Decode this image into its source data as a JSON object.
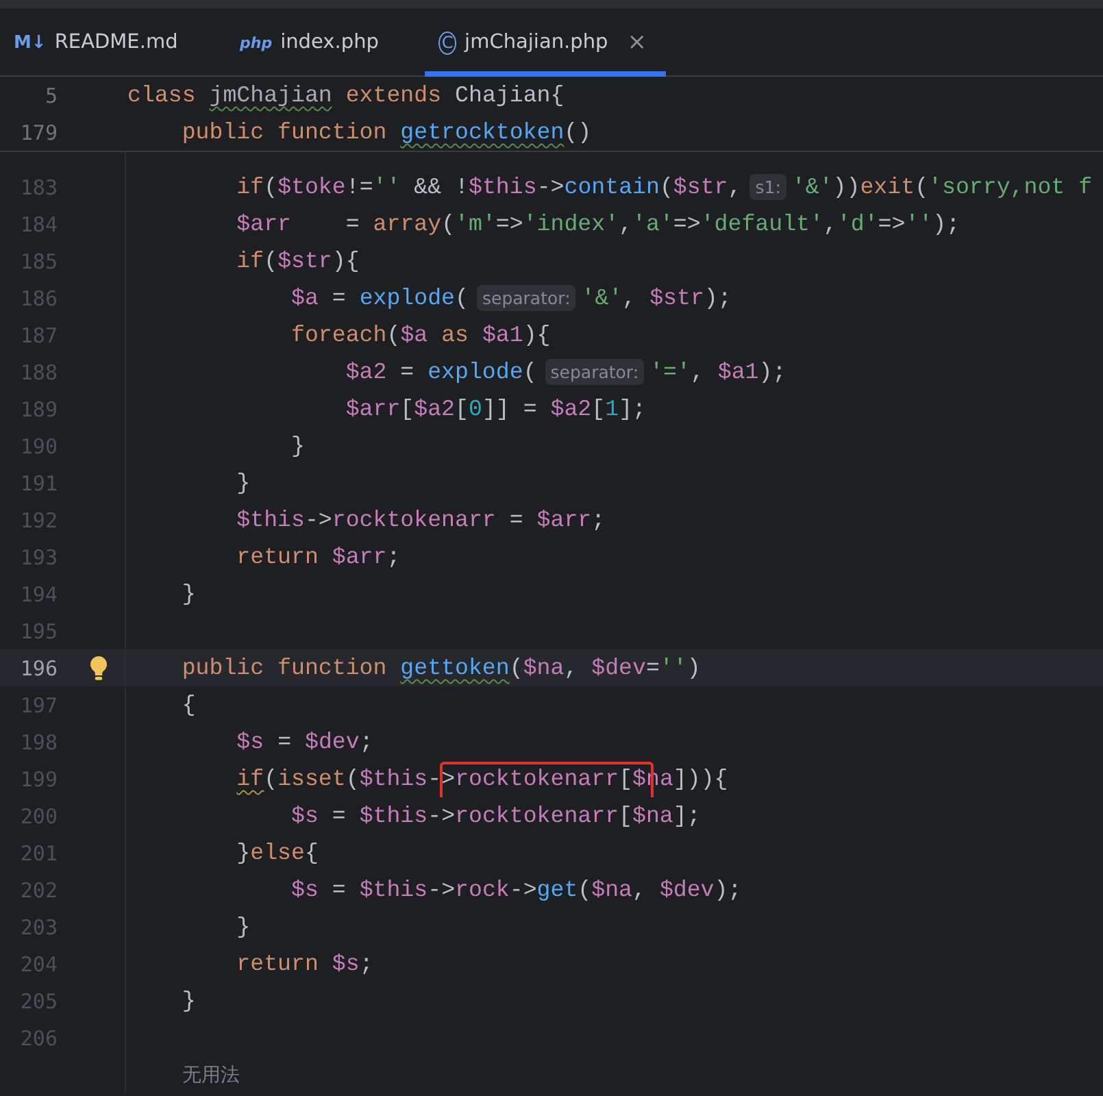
{
  "tabs": [
    {
      "kind": "markdown",
      "icon_text": "M↓",
      "label": "README.md",
      "selected": false
    },
    {
      "kind": "php",
      "icon_text": "php",
      "label": "index.php",
      "selected": false
    },
    {
      "kind": "class",
      "icon_text": "C",
      "label": "jmChajian.php",
      "selected": true,
      "close": "×"
    }
  ],
  "sticky_lines": [
    {
      "number": "5",
      "segments": [
        {
          "kind": "code",
          "tokens": [
            {
              "color": "#cf8e6d",
              "t": "class "
            },
            {
              "color": "#a9abb0",
              "t": "jmChajian",
              "typo": true
            },
            {
              "color": "#cf8e6d",
              "t": " extends"
            },
            {
              "color": "#bcbec4",
              "t": " Chajian{"
            }
          ]
        }
      ]
    },
    {
      "number": "179",
      "segments": [
        {
          "kind": "code",
          "tokens": [
            {
              "color": "#cf8e6d",
              "t": "    public function "
            },
            {
              "color": "#56a8f5",
              "t": "getrocktoken",
              "typo": true
            },
            {
              "color": "#bcbec4",
              "t": "()"
            }
          ]
        }
      ]
    }
  ],
  "lines": [
    {
      "number": "183",
      "segments": [
        {
          "kind": "code",
          "tokens": [
            {
              "color": "#cf8e6d",
              "t": "        if"
            },
            {
              "color": "#bcbec4",
              "t": "("
            },
            {
              "color": "#c77dbb",
              "t": "$toke"
            },
            {
              "color": "#bcbec4",
              "t": "!="
            },
            {
              "color": "#6aab73",
              "t": "''"
            },
            {
              "color": "#bcbec4",
              "t": " && !"
            },
            {
              "color": "#c77dbb",
              "t": "$this"
            },
            {
              "color": "#bcbec4",
              "t": "->"
            },
            {
              "color": "#56a8f5",
              "t": "contain"
            },
            {
              "color": "#bcbec4",
              "t": "("
            },
            {
              "color": "#c77dbb",
              "t": "$str"
            },
            {
              "color": "#bcbec4",
              "t": ","
            }
          ]
        },
        {
          "kind": "hint",
          "text": "s1:"
        },
        {
          "kind": "code",
          "tokens": [
            {
              "color": "#6aab73",
              "t": "'&'"
            },
            {
              "color": "#bcbec4",
              "t": "))"
            },
            {
              "color": "#cf8e6d",
              "t": "exit"
            },
            {
              "color": "#bcbec4",
              "t": "("
            },
            {
              "color": "#6aab73",
              "t": "'sorry,not f"
            }
          ]
        }
      ]
    },
    {
      "number": "184",
      "segments": [
        {
          "kind": "code",
          "tokens": [
            {
              "color": "#c77dbb",
              "t": "        $arr"
            },
            {
              "color": "#bcbec4",
              "t": "    = "
            },
            {
              "color": "#cf8e6d",
              "t": "array"
            },
            {
              "color": "#bcbec4",
              "t": "("
            },
            {
              "color": "#6aab73",
              "t": "'m'"
            },
            {
              "color": "#bcbec4",
              "t": "=>"
            },
            {
              "color": "#6aab73",
              "t": "'index'"
            },
            {
              "color": "#bcbec4",
              "t": ","
            },
            {
              "color": "#6aab73",
              "t": "'a'"
            },
            {
              "color": "#bcbec4",
              "t": "=>"
            },
            {
              "color": "#6aab73",
              "t": "'default'"
            },
            {
              "color": "#bcbec4",
              "t": ","
            },
            {
              "color": "#6aab73",
              "t": "'d'"
            },
            {
              "color": "#bcbec4",
              "t": "=>"
            },
            {
              "color": "#6aab73",
              "t": "''"
            },
            {
              "color": "#bcbec4",
              "t": ");"
            }
          ]
        }
      ]
    },
    {
      "number": "185",
      "segments": [
        {
          "kind": "code",
          "tokens": [
            {
              "color": "#cf8e6d",
              "t": "        if"
            },
            {
              "color": "#bcbec4",
              "t": "("
            },
            {
              "color": "#c77dbb",
              "t": "$str"
            },
            {
              "color": "#bcbec4",
              "t": "){"
            }
          ]
        }
      ]
    },
    {
      "number": "186",
      "segments": [
        {
          "kind": "code",
          "tokens": [
            {
              "color": "#c77dbb",
              "t": "            $a"
            },
            {
              "color": "#bcbec4",
              "t": " = "
            },
            {
              "color": "#56a8f5",
              "t": "explode"
            },
            {
              "color": "#bcbec4",
              "t": "("
            }
          ]
        },
        {
          "kind": "hint",
          "text": "separator:"
        },
        {
          "kind": "code",
          "tokens": [
            {
              "color": "#6aab73",
              "t": "'&'"
            },
            {
              "color": "#bcbec4",
              "t": ", "
            },
            {
              "color": "#c77dbb",
              "t": "$str"
            },
            {
              "color": "#bcbec4",
              "t": ");"
            }
          ]
        }
      ]
    },
    {
      "number": "187",
      "segments": [
        {
          "kind": "code",
          "tokens": [
            {
              "color": "#cf8e6d",
              "t": "            foreach"
            },
            {
              "color": "#bcbec4",
              "t": "("
            },
            {
              "color": "#c77dbb",
              "t": "$a "
            },
            {
              "color": "#cf8e6d",
              "t": "as "
            },
            {
              "color": "#c77dbb",
              "t": "$a1"
            },
            {
              "color": "#bcbec4",
              "t": "){"
            }
          ]
        }
      ]
    },
    {
      "number": "188",
      "segments": [
        {
          "kind": "code",
          "tokens": [
            {
              "color": "#c77dbb",
              "t": "                $a2"
            },
            {
              "color": "#bcbec4",
              "t": " = "
            },
            {
              "color": "#56a8f5",
              "t": "explode"
            },
            {
              "color": "#bcbec4",
              "t": "("
            }
          ]
        },
        {
          "kind": "hint",
          "text": "separator:"
        },
        {
          "kind": "code",
          "tokens": [
            {
              "color": "#6aab73",
              "t": "'='"
            },
            {
              "color": "#bcbec4",
              "t": ", "
            },
            {
              "color": "#c77dbb",
              "t": "$a1"
            },
            {
              "color": "#bcbec4",
              "t": ");"
            }
          ]
        }
      ]
    },
    {
      "number": "189",
      "segments": [
        {
          "kind": "code",
          "tokens": [
            {
              "color": "#c77dbb",
              "t": "                $arr"
            },
            {
              "color": "#bcbec4",
              "t": "["
            },
            {
              "color": "#c77dbb",
              "t": "$a2"
            },
            {
              "color": "#bcbec4",
              "t": "["
            },
            {
              "color": "#2aacb8",
              "t": "0"
            },
            {
              "color": "#bcbec4",
              "t": "]] = "
            },
            {
              "color": "#c77dbb",
              "t": "$a2"
            },
            {
              "color": "#bcbec4",
              "t": "["
            },
            {
              "color": "#2aacb8",
              "t": "1"
            },
            {
              "color": "#bcbec4",
              "t": "];"
            }
          ]
        }
      ]
    },
    {
      "number": "190",
      "segments": [
        {
          "kind": "code",
          "tokens": [
            {
              "color": "#bcbec4",
              "t": "            }"
            }
          ]
        }
      ]
    },
    {
      "number": "191",
      "segments": [
        {
          "kind": "code",
          "tokens": [
            {
              "color": "#bcbec4",
              "t": "        }"
            }
          ]
        }
      ]
    },
    {
      "number": "192",
      "segments": [
        {
          "kind": "code",
          "tokens": [
            {
              "color": "#c77dbb",
              "t": "        $this"
            },
            {
              "color": "#bcbec4",
              "t": "->"
            },
            {
              "color": "#c77dbb",
              "t": "rocktokenarr"
            },
            {
              "color": "#bcbec4",
              "t": " = "
            },
            {
              "color": "#c77dbb",
              "t": "$arr"
            },
            {
              "color": "#bcbec4",
              "t": ";"
            }
          ]
        }
      ]
    },
    {
      "number": "193",
      "segments": [
        {
          "kind": "code",
          "tokens": [
            {
              "color": "#cf8e6d",
              "t": "        return "
            },
            {
              "color": "#c77dbb",
              "t": "$arr"
            },
            {
              "color": "#bcbec4",
              "t": ";"
            }
          ]
        }
      ]
    },
    {
      "number": "194",
      "segments": [
        {
          "kind": "code",
          "tokens": [
            {
              "color": "#bcbec4",
              "t": "    }"
            }
          ]
        }
      ]
    },
    {
      "number": "195"
    },
    {
      "number": "196",
      "current": true,
      "bulb": true,
      "segments": [
        {
          "kind": "code",
          "tokens": [
            {
              "color": "#cf8e6d",
              "t": "    public function "
            },
            {
              "color": "#56a8f5",
              "t": "gettoken",
              "typo": true
            },
            {
              "color": "#bcbec4",
              "t": "("
            },
            {
              "color": "#c77dbb",
              "t": "$na"
            },
            {
              "color": "#bcbec4",
              "t": ", "
            },
            {
              "color": "#c77dbb",
              "t": "$dev"
            },
            {
              "color": "#bcbec4",
              "t": "="
            },
            {
              "color": "#6aab73",
              "t": "''"
            },
            {
              "color": "#bcbec4",
              "t": ")"
            }
          ]
        }
      ]
    },
    {
      "number": "197",
      "segments": [
        {
          "kind": "code",
          "tokens": [
            {
              "color": "#bcbec4",
              "t": "    {"
            }
          ]
        }
      ]
    },
    {
      "number": "198",
      "segments": [
        {
          "kind": "code",
          "tokens": [
            {
              "color": "#c77dbb",
              "t": "        $s"
            },
            {
              "color": "#bcbec4",
              "t": " = "
            },
            {
              "color": "#c77dbb",
              "t": "$dev"
            },
            {
              "color": "#bcbec4",
              "t": ";"
            }
          ]
        }
      ]
    },
    {
      "number": "199",
      "segments": [
        {
          "kind": "code",
          "tokens": [
            {
              "color": "#cf8e6d",
              "t": "        if",
              "warning": true
            },
            {
              "color": "#bcbec4",
              "t": "("
            },
            {
              "color": "#cf8e6d",
              "t": "isset"
            },
            {
              "color": "#bcbec4",
              "t": "("
            },
            {
              "color": "#c77dbb",
              "t": "$this"
            },
            {
              "color": "#bcbec4",
              "t": "-"
            },
            {
              "color": "#bcbec4",
              "t": ">",
              "boxed": true
            },
            {
              "color": "#c77dbb",
              "t": "rocktokenarr",
              "boxed": true
            },
            {
              "color": "#bcbec4",
              "t": "[",
              "boxed": true
            },
            {
              "color": "#c77dbb",
              "t": "$",
              "boxed": true
            },
            {
              "color": "#c77dbb",
              "t": "na"
            },
            {
              "color": "#bcbec4",
              "t": "])){"
            }
          ]
        }
      ]
    },
    {
      "number": "200",
      "segments": [
        {
          "kind": "code",
          "tokens": [
            {
              "color": "#c77dbb",
              "t": "            $s"
            },
            {
              "color": "#bcbec4",
              "t": " = "
            },
            {
              "color": "#c77dbb",
              "t": "$this"
            },
            {
              "color": "#bcbec4",
              "t": "->"
            },
            {
              "color": "#c77dbb",
              "t": "rocktokenarr"
            },
            {
              "color": "#bcbec4",
              "t": "["
            },
            {
              "color": "#c77dbb",
              "t": "$na"
            },
            {
              "color": "#bcbec4",
              "t": "];"
            }
          ]
        }
      ]
    },
    {
      "number": "201",
      "segments": [
        {
          "kind": "code",
          "tokens": [
            {
              "color": "#bcbec4",
              "t": "        }"
            },
            {
              "color": "#cf8e6d",
              "t": "else"
            },
            {
              "color": "#bcbec4",
              "t": "{"
            }
          ]
        }
      ]
    },
    {
      "number": "202",
      "segments": [
        {
          "kind": "code",
          "tokens": [
            {
              "color": "#c77dbb",
              "t": "            $s"
            },
            {
              "color": "#bcbec4",
              "t": " = "
            },
            {
              "color": "#c77dbb",
              "t": "$this"
            },
            {
              "color": "#bcbec4",
              "t": "->"
            },
            {
              "color": "#c77dbb",
              "t": "rock"
            },
            {
              "color": "#bcbec4",
              "t": "->"
            },
            {
              "color": "#56a8f5",
              "t": "get"
            },
            {
              "color": "#bcbec4",
              "t": "("
            },
            {
              "color": "#c77dbb",
              "t": "$na"
            },
            {
              "color": "#bcbec4",
              "t": ", "
            },
            {
              "color": "#c77dbb",
              "t": "$dev"
            },
            {
              "color": "#bcbec4",
              "t": ");"
            }
          ]
        }
      ]
    },
    {
      "number": "203",
      "segments": [
        {
          "kind": "code",
          "tokens": [
            {
              "color": "#bcbec4",
              "t": "        }"
            }
          ]
        }
      ]
    },
    {
      "number": "204",
      "segments": [
        {
          "kind": "code",
          "tokens": [
            {
              "color": "#cf8e6d",
              "t": "        return "
            },
            {
              "color": "#c77dbb",
              "t": "$s"
            },
            {
              "color": "#bcbec4",
              "t": ";"
            }
          ]
        }
      ]
    },
    {
      "number": "205",
      "segments": [
        {
          "kind": "code",
          "tokens": [
            {
              "color": "#bcbec4",
              "t": "    }"
            }
          ]
        }
      ]
    },
    {
      "number": "206"
    }
  ],
  "code_lens": "无用法"
}
